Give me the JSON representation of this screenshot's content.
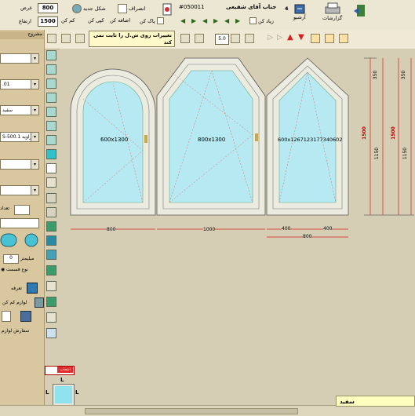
{
  "toolbar": {
    "order_label": "جناب آقای شفیعی",
    "order_number": "#050011",
    "page_number": "4",
    "width_label": "عرض",
    "width_value": "800",
    "height_label": "ارتفاع",
    "height_value": "1500",
    "btn_cancel": "انصراف",
    "btn_new_shape": "شکل جدید",
    "btn_add": "اضافه کن",
    "btn_clear": "پاک کن",
    "btn_copy": "کپی کن",
    "btn_new": "جدید",
    "btn_archive": "آرشیو",
    "btn_reports": "گزارشات",
    "btn_zoom_in": "زیاد کن",
    "btn_zoom_out": "کم کن",
    "btn_exit": "خروج"
  },
  "toolbar2": {
    "note": "تغییرات روی ش.ل را ثابت نمی کند",
    "zoom_value": "5.0"
  },
  "leftpanel": {
    "header": "مشروح",
    "dropdowns": [
      "",
      "",
      ".01",
      "سفید",
      "S-500.1 زاویه",
      "",
      "",
      "",
      ""
    ],
    "label_count": "تعداد",
    "label_mm": "میلیمتر",
    "mm_value": "0",
    "label_section": "نوع قسمت",
    "label_tariff": "تعرفه",
    "label_accessories": "لوازم کم کن",
    "label_order": "سفارش لوازم"
  },
  "windows": [
    {
      "label": "600x1300"
    },
    {
      "label": "800x1300"
    },
    {
      "label": "600x1267123177340602"
    }
  ],
  "dimensions": {
    "bottom": [
      "800",
      "1000",
      "400",
      "400",
      "800"
    ],
    "right_total": "1500",
    "right_a": "1150",
    "right_b": "350",
    "right_c": "1500",
    "right_d": "1150",
    "right_e": "350"
  },
  "status": {
    "color_name": "سفید",
    "mini_label_top": "L",
    "mini_label_left": "L",
    "mini_label_right": "L",
    "mini_label_bottom": "L",
    "red_tag": "انتخاب"
  },
  "colors": {
    "glass": "#b6e9f1",
    "frame": "#ecebe0",
    "dim_line": "#d11c1c",
    "toolbar_bg": "#ece7d3"
  }
}
